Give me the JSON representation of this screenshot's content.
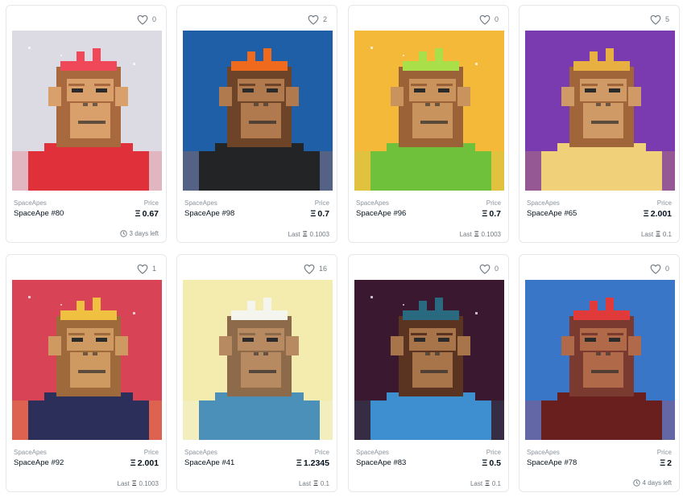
{
  "cards": [
    {
      "collection": "SpaceApes",
      "name": "SpaceApe #80",
      "price_label": "Price",
      "price": "0.67",
      "likes": "0",
      "footer_type": "time",
      "footer_text": "3 days left",
      "palette": {
        "bg": "#dcdbe4",
        "fur": "#a9693e",
        "face": "#d9a06c",
        "suit": "#e0303a",
        "accent": "#f04858",
        "eye": "#2b2b2b"
      }
    },
    {
      "collection": "SpaceApes",
      "name": "SpaceApe #98",
      "price_label": "Price",
      "price": "0.7",
      "likes": "2",
      "footer_type": "last",
      "last_label": "Last",
      "footer_text": "0.1003",
      "palette": {
        "bg": "#1f5fa8",
        "fur": "#6d4428",
        "face": "#b07a4e",
        "suit": "#222426",
        "accent": "#ef6a1c",
        "eye": "#2b2b2b"
      }
    },
    {
      "collection": "SpaceApes",
      "name": "SpaceApe #96",
      "price_label": "Price",
      "price": "0.7",
      "likes": "0",
      "footer_type": "last",
      "last_label": "Last",
      "footer_text": "0.1003",
      "palette": {
        "bg": "#f5b93a",
        "fur": "#9a6236",
        "face": "#c8935c",
        "suit": "#6fc03a",
        "accent": "#a9e04a",
        "eye": "#2b2b2b"
      }
    },
    {
      "collection": "SpaceApes",
      "name": "SpaceApe #65",
      "price_label": "Price",
      "price": "2.001",
      "likes": "5",
      "footer_type": "last",
      "last_label": "Last",
      "footer_text": "0.1",
      "palette": {
        "bg": "#7a3bb0",
        "fur": "#a0663a",
        "face": "#cf9a66",
        "suit": "#f1d07a",
        "accent": "#e8b040",
        "eye": "#2b2b2b"
      }
    },
    {
      "collection": "SpaceApes",
      "name": "SpaceApe #92",
      "price_label": "Price",
      "price": "2.001",
      "likes": "1",
      "footer_type": "last",
      "last_label": "Last",
      "footer_text": "0.1003",
      "palette": {
        "bg": "#d94356",
        "fur": "#9e6a3c",
        "face": "#cf9a62",
        "suit": "#2c2f5a",
        "accent": "#f0c040",
        "eye": "#2b2b2b"
      }
    },
    {
      "collection": "SpaceApes",
      "name": "SpaceApe #41",
      "price_label": "Price",
      "price": "1.2345",
      "likes": "16",
      "footer_type": "last",
      "last_label": "Last",
      "footer_text": "0.1",
      "palette": {
        "bg": "#f3ecae",
        "fur": "#8d6a4a",
        "face": "#b88a62",
        "suit": "#4a90b8",
        "accent": "#f5f5f0",
        "eye": "#2b2b2b"
      }
    },
    {
      "collection": "SpaceApes",
      "name": "SpaceApe #83",
      "price_label": "Price",
      "price": "0.5",
      "likes": "0",
      "footer_type": "last",
      "last_label": "Last",
      "footer_text": "0.1",
      "palette": {
        "bg": "#3a1830",
        "fur": "#5a3420",
        "face": "#a8754a",
        "suit": "#3d8fd0",
        "accent": "#2a6a80",
        "eye": "#2b2b2b"
      }
    },
    {
      "collection": "SpaceApes",
      "name": "SpaceApe #78",
      "price_label": "Price",
      "price": "2",
      "likes": "0",
      "footer_type": "time",
      "footer_text": "4 days left",
      "palette": {
        "bg": "#3a76c8",
        "fur": "#7a3a30",
        "face": "#b06a4a",
        "suit": "#6a1f1f",
        "accent": "#e03a3a",
        "eye": "#2b2b2b"
      }
    }
  ],
  "icons": {
    "heart": "heart-icon",
    "eth": "eth-icon",
    "clock": "clock-icon"
  }
}
